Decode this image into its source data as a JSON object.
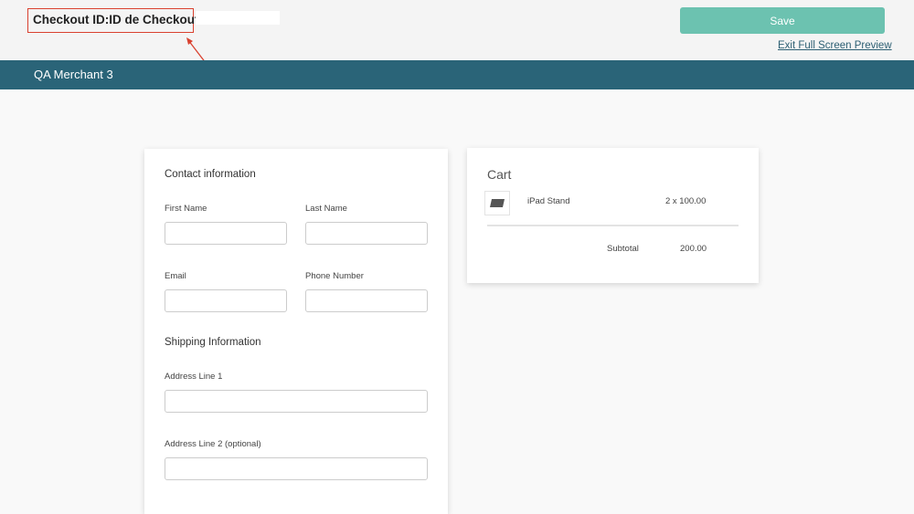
{
  "header": {
    "checkout_id_label": "Checkout ID:ID de Checkout :",
    "checkout_id_value": "",
    "save_label": "Save",
    "exit_label": "Exit Full Screen Preview"
  },
  "banner": {
    "merchant": "QA Merchant 3"
  },
  "form": {
    "contact_title": "Contact information",
    "first_name": {
      "label": "First Name",
      "value": ""
    },
    "last_name": {
      "label": "Last Name",
      "value": ""
    },
    "email": {
      "label": "Email",
      "value": ""
    },
    "phone": {
      "label": "Phone Number",
      "value": ""
    },
    "shipping_title": "Shipping Information",
    "address1": {
      "label": "Address Line 1",
      "value": ""
    },
    "address2": {
      "label": "Address Line 2 (optional)",
      "value": ""
    }
  },
  "cart": {
    "title": "Cart",
    "items": [
      {
        "name": "iPad Stand",
        "qty_price": "2 x 100.00"
      }
    ],
    "subtotal_label": "Subtotal",
    "subtotal_value": "200.00"
  },
  "colors": {
    "accent": "#6cc2b0",
    "banner": "#2a6478",
    "annotation": "#d9412f"
  }
}
